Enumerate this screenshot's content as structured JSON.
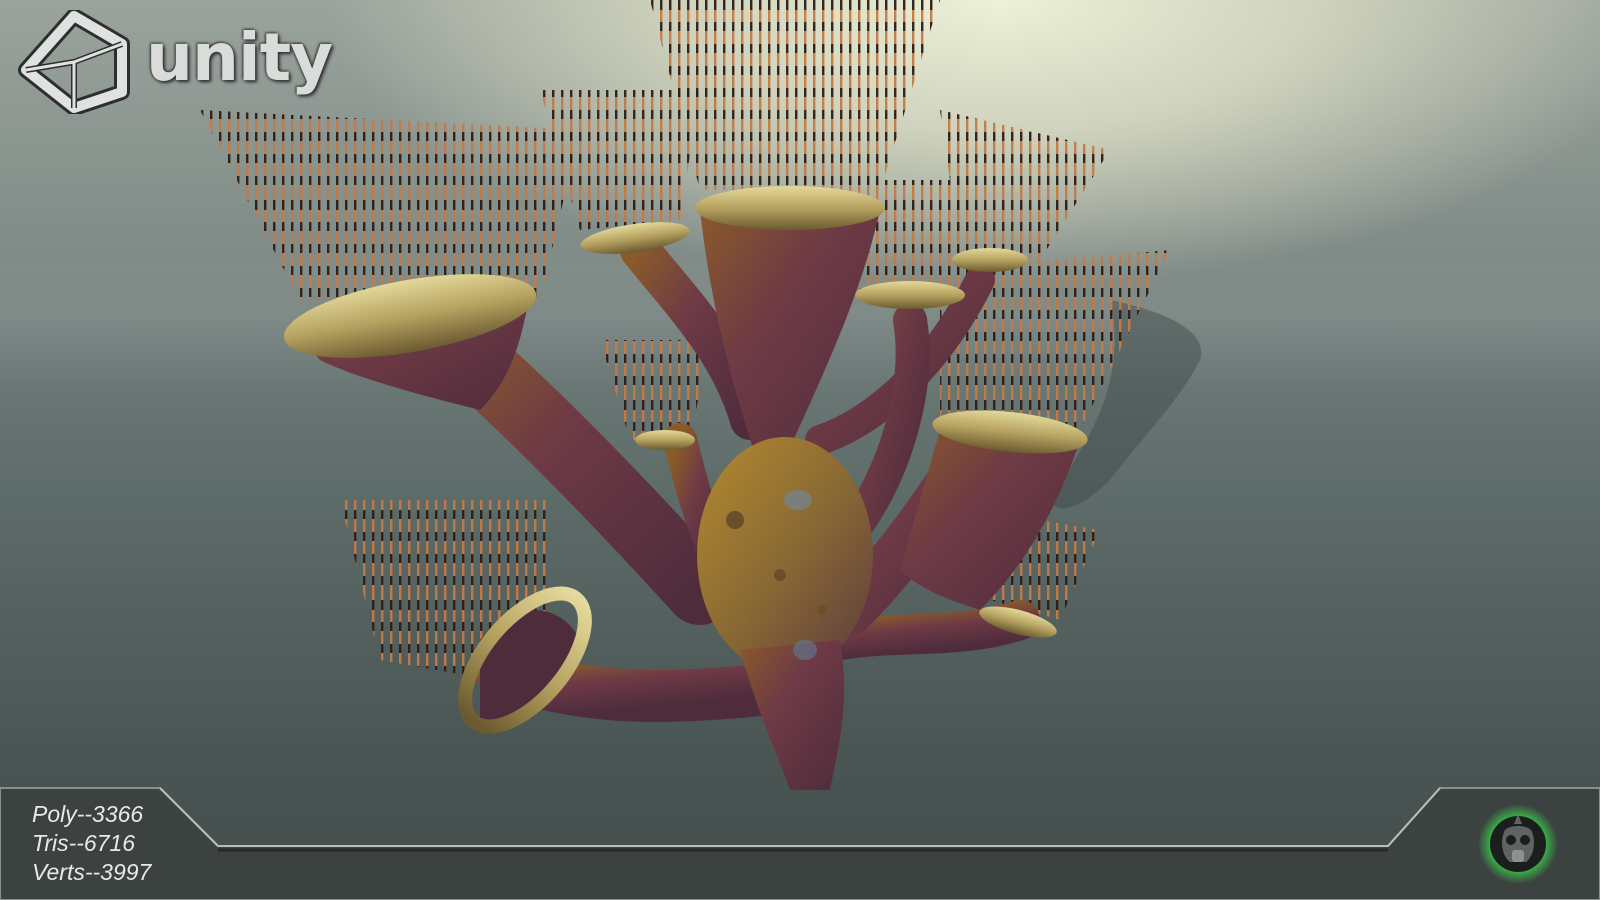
{
  "brand": {
    "logo_icon": "unity-cube-icon",
    "name": "unity"
  },
  "stats": {
    "poly": "Poly--3366",
    "tris": "Tris--6716",
    "verts": "Verts--3997"
  },
  "badge": {
    "icon": "gas-mask-icon",
    "glow_color": "#38e04a"
  },
  "colors": {
    "background_top": "#eef0d8",
    "background_bottom": "#434d4b",
    "panel": "#3c4240",
    "panel_border": "#8a908e"
  }
}
